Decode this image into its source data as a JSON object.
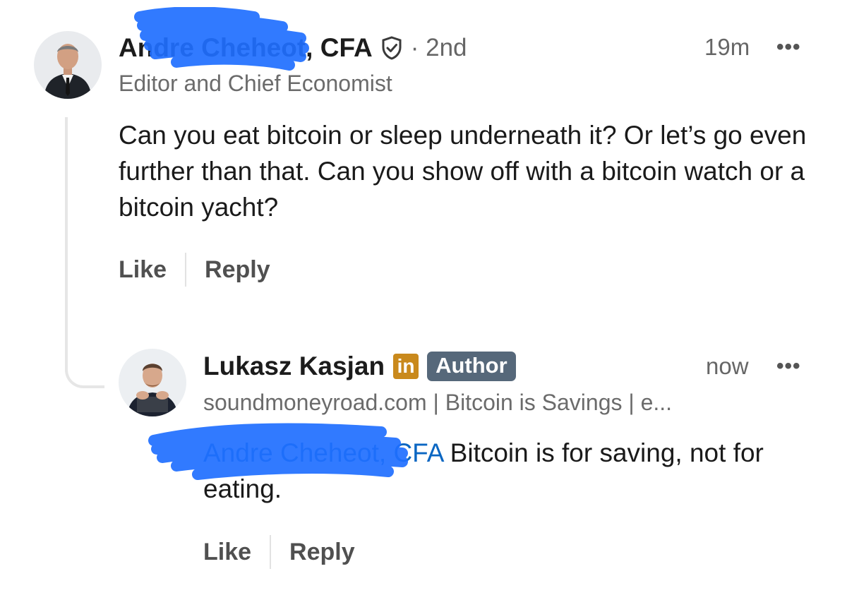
{
  "comment": {
    "author_name": "Andre Cheheot, CFA",
    "degree": "· 2nd",
    "headline": "Editor and Chief Economist",
    "time": "19m",
    "more_label": "•••",
    "body": "Can you eat bitcoin or sleep underneath it? Or let’s go even further than that. Can you show off with a bitcoin watch or a bitcoin yacht?",
    "like_label": "Like",
    "reply_label": "Reply"
  },
  "reply": {
    "author_name": "Lukasz Kasjan",
    "linkedin_badge": "in",
    "author_badge": "Author",
    "headline": "soundmoneyroad.com | Bitcoin is Savings | e...",
    "time": "now",
    "more_label": "•••",
    "mention": "Andre Cheheot, CFA",
    "body": " Bitcoin is for saving, not for eating.",
    "like_label": "Like",
    "reply_label": "Reply"
  },
  "colors": {
    "mention": "#0a66c2",
    "linkedin_badge": "#c9891c",
    "author_badge": "#56687a",
    "redaction": "#1f6fff"
  },
  "icons": {
    "verified": "shield-check-icon",
    "more": "more-options-icon"
  }
}
